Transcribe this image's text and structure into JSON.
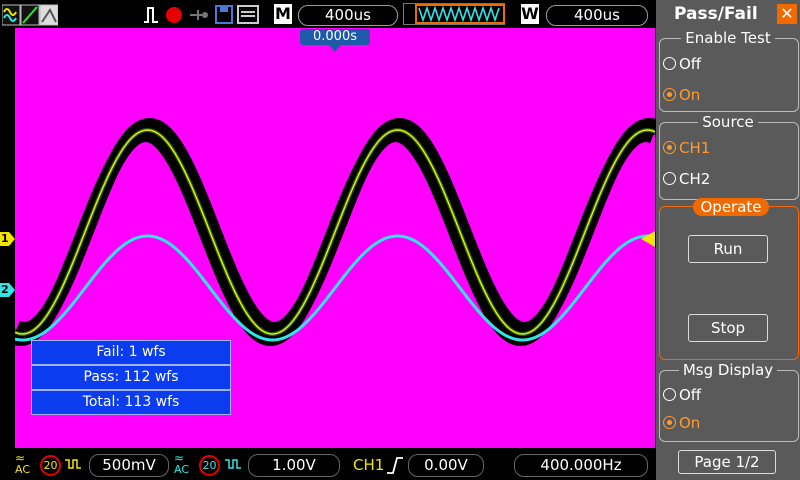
{
  "topbar": {
    "mode_letter": "M",
    "timebase": "400us",
    "window_letter": "W",
    "window_timebase": "400us",
    "trigger_time": "0.000s"
  },
  "markers": {
    "ch1": "1",
    "ch2": "2"
  },
  "results": {
    "fail": "Fail:  1 wfs",
    "pass": "Pass:  112 wfs",
    "total": "Total:  113 wfs"
  },
  "bottombar": {
    "ch1_coupling": "AC",
    "ch1_bw": "20",
    "ch1_scale": "500mV",
    "ch2_coupling": "AC",
    "ch2_bw": "20",
    "ch2_scale": "1.00V",
    "trigger_source": "CH1",
    "trigger_level": "0.00V",
    "frequency": "400.000Hz"
  },
  "panel": {
    "title": "Pass/Fail",
    "enable_test": {
      "label": "Enable Test",
      "options": [
        "Off",
        "On"
      ],
      "selected": "On"
    },
    "source": {
      "label": "Source",
      "options": [
        "CH1",
        "CH2"
      ],
      "selected": "CH1"
    },
    "operate": {
      "label": "Operate",
      "run": "Run",
      "stop": "Stop"
    },
    "msg_display": {
      "label": "Msg Display",
      "options": [
        "Off",
        "On"
      ],
      "selected": "On"
    },
    "page": "Page 1/2"
  },
  "colors": {
    "screen": "#ff00ff",
    "ch1": "#f2e600",
    "ch2": "#2ee6e6",
    "mask": "#000000",
    "accent": "#f06a00"
  }
}
